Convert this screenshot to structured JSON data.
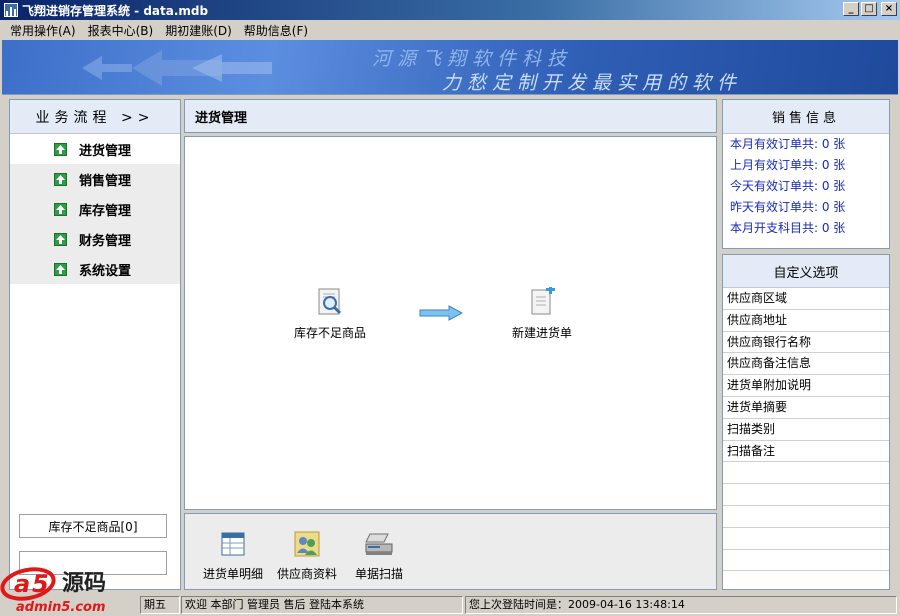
{
  "window": {
    "title": "飞翔进销存管理系统 - data.mdb",
    "minimize": "_",
    "maximize": "□",
    "close": "×"
  },
  "menu": [
    "常用操作(A)",
    "报表中心(B)",
    "期初建账(D)",
    "帮助信息(F)"
  ],
  "banner": {
    "line1": "河源飞翔软件科技",
    "line2": "力愁定制开发最实用的软件"
  },
  "left_panel": {
    "title": "业务流程 >>",
    "items": [
      "进货管理",
      "销售管理",
      "库存管理",
      "财务管理",
      "系统设置"
    ],
    "bottom_button": "库存不足商品[0]",
    "bottom_button2": ""
  },
  "center": {
    "title": "进货管理",
    "flow": {
      "node1": "库存不足商品",
      "node2": "新建进货单"
    },
    "tools": [
      "进货单明细",
      "供应商资料",
      "单据扫描"
    ]
  },
  "sales_info": {
    "title": "销售信息",
    "lines": [
      "本月有效订单共: 0 张",
      "上月有效订单共: 0 张",
      "今天有效订单共: 0 张",
      "昨天有效订单共: 0 张",
      "本月开支科目共: 0 张"
    ]
  },
  "custom_options": {
    "title": "自定义选项",
    "items": [
      "供应商区域",
      "供应商地址",
      "供应商银行名称",
      "供应商备注信息",
      "进货单附加说明",
      "进货单摘要",
      "扫描类别",
      "扫描备注",
      "",
      "",
      "",
      "",
      "",
      ""
    ]
  },
  "status": {
    "day": "期五",
    "welcome": "欢迎 本部门 管理员 售后 登陆本系统",
    "last_login": "您上次登陆时间是：2009-04-16 13:48:14"
  },
  "watermark": {
    "text": "a5源码",
    "url": "admin5.com"
  },
  "colors": {
    "accent_red": "#e01818",
    "sales_text": "#1a2bb8",
    "panel_header": "#e4ebf7",
    "nav_icon": "#2e9e46"
  }
}
